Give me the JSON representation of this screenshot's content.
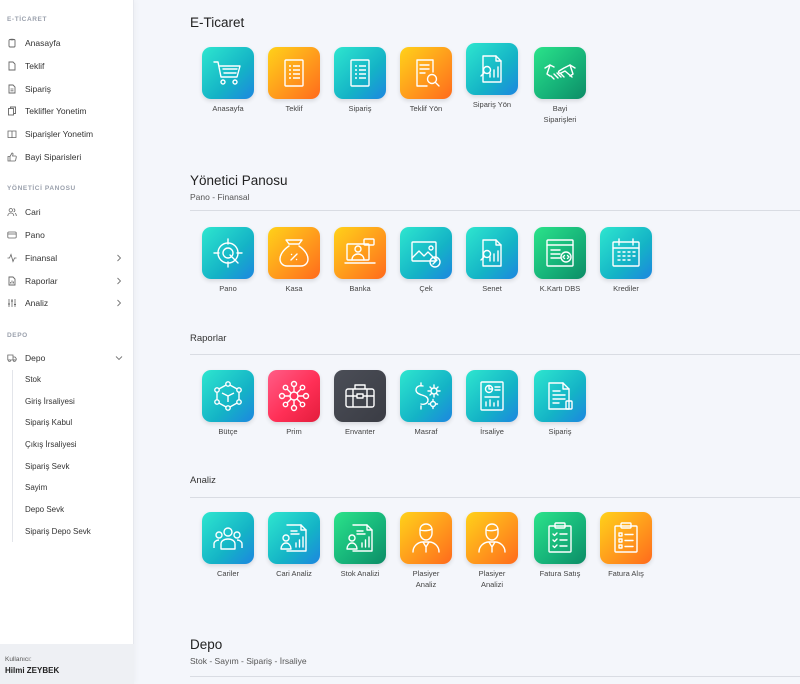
{
  "sidebar": {
    "eticaret_head": "E-TİCARET",
    "eticaret_items": [
      "Anasayfa",
      "Teklif",
      "Sipariş",
      "Teklifler Yonetim",
      "Siparişler Yonetim",
      "Bayi Siparisleri"
    ],
    "yonetici_head": "YÖNETİCİ PANOSU",
    "yonetici_items": [
      "Cari",
      "Pano",
      "Finansal",
      "Raporlar",
      "Analiz"
    ],
    "depo_head": "DEPO",
    "depo_item": "Depo",
    "depo_sub": [
      "Stok",
      "Giriş İrsaliyesi",
      "Sipariş Kabul",
      "Çıkış İrsaliyesi",
      "Sipariş Sevk",
      "Sayim",
      "Depo Sevk",
      "Sipariş Depo Sevk"
    ],
    "user_label": "Kullanıcı:",
    "user_name": "Hilmi ZEYBEK"
  },
  "sections": {
    "eticaret": {
      "title": "E-Ticaret",
      "tiles": [
        "Anasayfa",
        "Teklif",
        "Sipariş",
        "Teklif Yön",
        "Sipariş Yön",
        "Bayi Siparişleri"
      ]
    },
    "yonetici": {
      "title": "Yönetici Panosu",
      "subtitle": "Pano - Finansal",
      "tiles": [
        "Pano",
        "Kasa",
        "Banka",
        "Çek",
        "Senet",
        "K.Kartı DBS",
        "Krediler"
      ]
    },
    "raporlar": {
      "title": "Raporlar",
      "tiles": [
        "Bütçe",
        "Prim",
        "Envanter",
        "Masraf",
        "İrsaliye",
        "Sipariş"
      ]
    },
    "analiz": {
      "title": "Analiz",
      "tiles": [
        "Cariler",
        "Cari Analiz",
        "Stok Analizi",
        "Plasiyer Analiz",
        "Plasiyer Analizi",
        "Fatura Satış",
        "Fatura Alış"
      ]
    },
    "depo": {
      "title": "Depo",
      "subtitle": "Stok - Sayım - Sipariş - İrsaliye"
    }
  },
  "icons": {
    "eticaret": [
      "cart-icon",
      "document-list-icon",
      "document-list-icon",
      "document-search-icon",
      "report-search-icon",
      "handshake-icon"
    ],
    "yonetici": [
      "target-icon",
      "money-bag-icon",
      "presenter-icon",
      "check-image-icon",
      "report-chart-icon",
      "code-card-icon",
      "calendar-icon"
    ],
    "raporlar": [
      "network-cube-icon",
      "hub-icon",
      "briefcase-icon",
      "dollar-gear-icon",
      "report-pie-icon",
      "document-edit-icon"
    ],
    "analiz": [
      "team-icon",
      "user-report-icon",
      "user-chart-icon",
      "salesman-icon",
      "salesman-icon",
      "clipboard-check-icon",
      "clipboard-list-icon"
    ]
  },
  "colors": {
    "teal": "#14b3c6",
    "orange": "#ff9a1c",
    "green": "#17b57a",
    "red": "#ff2f56",
    "dark": "#3a3c44"
  }
}
